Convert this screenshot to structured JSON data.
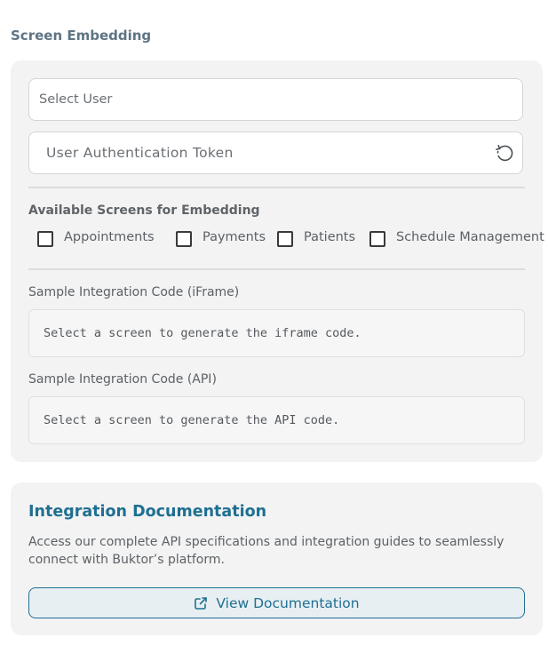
{
  "section": {
    "title": "Screen Embedding"
  },
  "embed": {
    "user_select": {
      "placeholder": "Select User"
    },
    "token_field": {
      "placeholder": "User Authentication Token",
      "refresh_icon": "refresh-icon"
    },
    "screens_label": "Available Screens for Embedding",
    "screens": [
      {
        "label": "Appointments",
        "checked": false
      },
      {
        "label": "Payments",
        "checked": false
      },
      {
        "label": "Patients",
        "checked": false
      },
      {
        "label": "Schedule Management",
        "checked": false
      }
    ],
    "iframe_code": {
      "label": "Sample Integration Code (iFrame)",
      "placeholder": "Select a screen to generate the iframe code."
    },
    "api_code": {
      "label": "Sample Integration Code (API)",
      "placeholder": "Select a screen to generate the API code."
    }
  },
  "docs": {
    "title": "Integration Documentation",
    "description": "Access our complete API specifications and integration guides to seamlessly connect with Buktor’s platform.",
    "button_label": "View Documentation",
    "button_icon": "external-link-icon"
  },
  "colors": {
    "accent": "#1f6f92",
    "section_title": "#5f7483",
    "card_bg": "#f3f3f3"
  }
}
